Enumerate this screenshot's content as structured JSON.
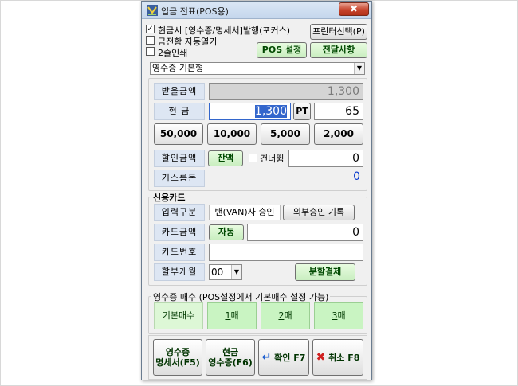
{
  "window": {
    "title": "입금 전표(POS용)",
    "close_symbol": "✖"
  },
  "print_options": {
    "issue_receipt": {
      "label": "현금시 [영수증/명세서]발행(포커스)",
      "checked": true
    },
    "auto_open_drawer": {
      "label": "금전함 자동열기",
      "checked": false
    },
    "print_twice": {
      "label": "2줄인쇄",
      "checked": false
    }
  },
  "buttons": {
    "printer_select": "프린터선택(P)",
    "pos_settings": "POS 설정",
    "notice": "전달사항"
  },
  "receipt_type": {
    "selected": "영수증 기본형",
    "arrow": "▼"
  },
  "payment": {
    "receivable_label": "받을금액",
    "receivable_value": "1,300",
    "cash_label": "현      금",
    "cash_value": "1,300",
    "pt_label": "PT",
    "pt_value": "65",
    "cash_amounts": [
      "50,000",
      "10,000",
      "5,000",
      "2,000"
    ],
    "discount_label": "할인금액",
    "balance_button": "잔액",
    "skip_label": "건너뜀",
    "skip_checked": false,
    "discount_value": "0",
    "change_label": "거스름돈",
    "change_value": "0"
  },
  "card": {
    "section_title": "신용카드",
    "input_type_label": "입력구분",
    "van_approval": "밴(VAN)사 승인",
    "external_approval": "외부승인 기록",
    "card_amount_label": "카드금액",
    "auto_button": "자동",
    "card_amount_value": "0",
    "card_number_label": "카드번호",
    "card_number_value": "",
    "installment_label": "할부개월",
    "installment_value": "00",
    "split_payment": "분할결제"
  },
  "copies": {
    "section_title": "영수증 매수 (POS설정에서 기본매수 설정 가능)",
    "default_label": "기본매수",
    "options": [
      {
        "num": "1",
        "suffix": "매"
      },
      {
        "num": "2",
        "suffix": "매"
      },
      {
        "num": "3",
        "suffix": "매"
      }
    ]
  },
  "actions": {
    "statement": {
      "line1": "영수증",
      "line2": "명세서(F5)"
    },
    "cash_receipt": {
      "line1": "현금",
      "line2": "영수증(F6)"
    },
    "confirm": "확인 F7",
    "cancel": "취소 F8"
  },
  "colors": {
    "accent_blue": "#0033cc",
    "label_bg": "#dde6f3",
    "copy_bg": "#c9f4c2",
    "selected_text_bg": "#3366cc"
  }
}
